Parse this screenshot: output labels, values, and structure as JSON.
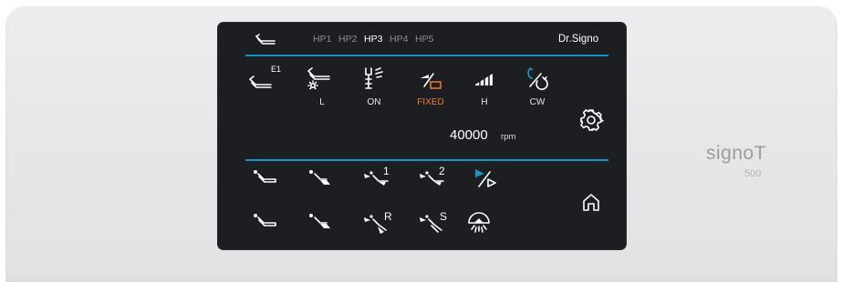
{
  "device": {
    "brand_name": "signoT",
    "model_number": "500"
  },
  "header": {
    "handpiece_tabs": [
      "HP1",
      "HP2",
      "HP3",
      "HP4",
      "HP5"
    ],
    "active_tab": "HP3",
    "brand": "Dr.Signo"
  },
  "settings_row": {
    "profile_label": "E1",
    "light_label": "L",
    "spray_label": "ON",
    "speed_mode_label": "FIXED",
    "torque_label": "H",
    "rotation_label": "CW"
  },
  "speed": {
    "value": "40000",
    "unit": "rpm"
  },
  "programs": {
    "row1_labels": [
      "1",
      "2"
    ],
    "row2_labels": [
      "R",
      "S"
    ]
  },
  "colors": {
    "accent_blue": "#1793c7",
    "warning_orange": "#f07a3a",
    "screen_bg": "#1d1e21",
    "text": "#ffffff",
    "muted_tab": "#8b8d92"
  },
  "icons": [
    "handpiece-icon",
    "handpiece-profile-icon",
    "handpiece-light-icon",
    "spray-icon",
    "speed-mode-icon",
    "torque-level-icon",
    "rotation-direction-icon",
    "gear-icon",
    "home-icon",
    "program-icon",
    "operating-light-icon"
  ]
}
